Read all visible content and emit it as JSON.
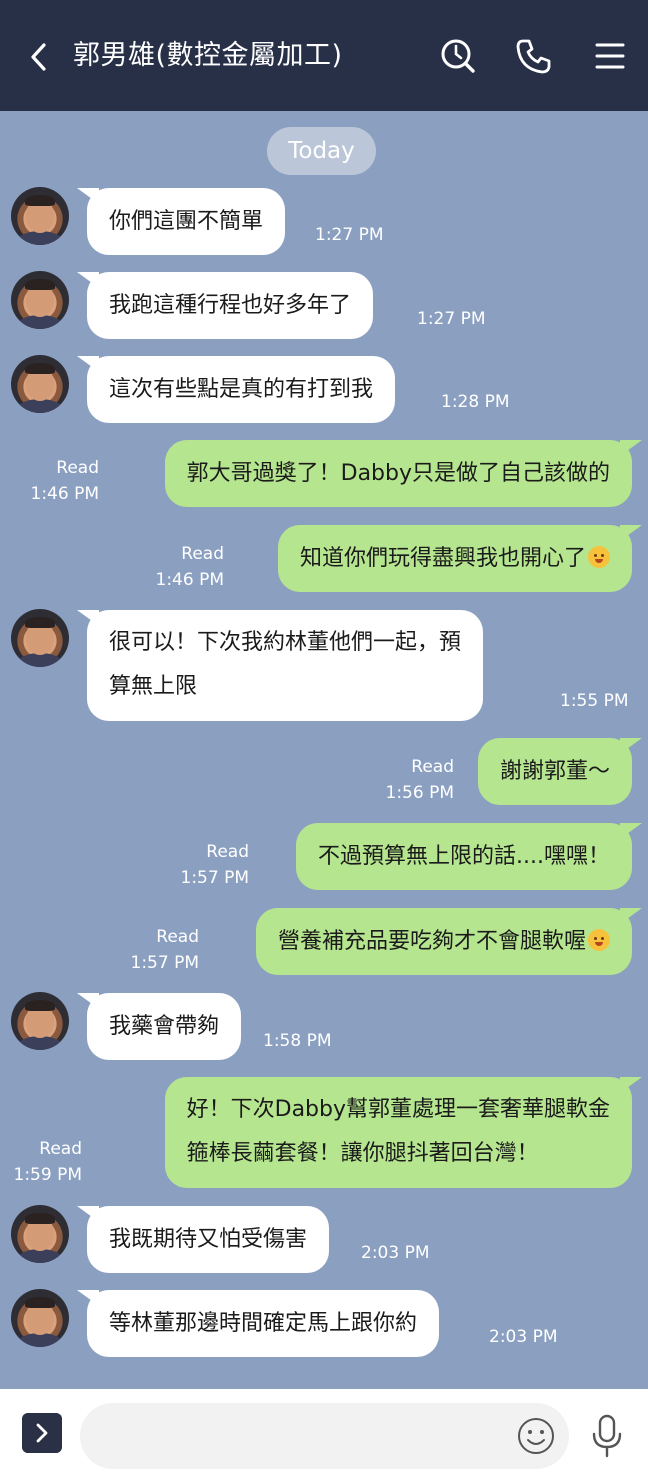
{
  "header": {
    "title": "郭男雄(數控金屬加工)"
  },
  "date_label": "Today",
  "messages": [
    {
      "side": "in",
      "text": "你們這團不簡單",
      "time": "1:27 PM"
    },
    {
      "side": "in",
      "text": "我跑這種行程也好多年了",
      "time": "1:27 PM"
    },
    {
      "side": "in",
      "text": "這次有些點是真的有打到我",
      "time": "1:28 PM"
    },
    {
      "side": "out",
      "text": "郭大哥過獎了！Dabby只是做了自己該做的",
      "read": "Read",
      "time": "1:46 PM"
    },
    {
      "side": "out",
      "text": "知道你們玩得盡興我也開心了",
      "emoji": "kissing-face-emoji",
      "read": "Read",
      "time": "1:46 PM"
    },
    {
      "side": "in",
      "lines": [
        "很可以！下次我約林董他們一起，預",
        "算無上限"
      ],
      "time": "1:55 PM"
    },
    {
      "side": "out",
      "text": "謝謝郭董～",
      "read": "Read",
      "time": "1:56 PM"
    },
    {
      "side": "out",
      "text": "不過預算無上限的話....嘿嘿！",
      "read": "Read",
      "time": "1:57 PM"
    },
    {
      "side": "out",
      "text": "營養補充品要吃夠才不會腿軟喔",
      "emoji": "rofl-emoji",
      "read": "Read",
      "time": "1:57 PM"
    },
    {
      "side": "in",
      "text": "我藥會帶夠",
      "time": "1:58 PM"
    },
    {
      "side": "out",
      "lines": [
        "好！下次Dabby幫郭董處理一套奢華腿軟金",
        "箍棒長繭套餐！讓你腿抖著回台灣！"
      ],
      "read": "Read",
      "time": "1:59 PM"
    },
    {
      "side": "in",
      "text": "我既期待又怕受傷害",
      "time": "2:03 PM"
    },
    {
      "side": "in",
      "text": "等林董那邊時間確定馬上跟你約",
      "time": "2:03 PM"
    }
  ],
  "colors": {
    "header_bg": "#283048",
    "chat_bg": "#8ba0c1",
    "out_bubble": "#b6e58f",
    "in_bubble": "#ffffff"
  }
}
